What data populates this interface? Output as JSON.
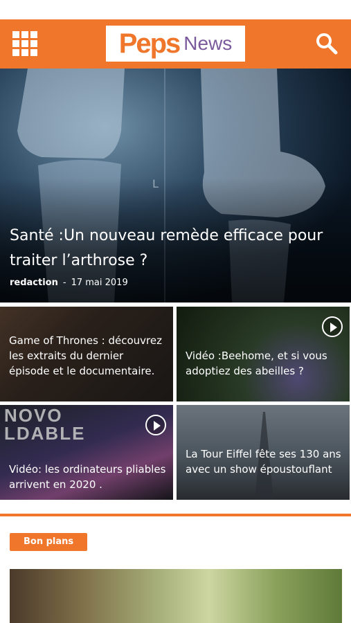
{
  "header": {
    "logo_part1": "Peps",
    "logo_part2": "News",
    "menu_icon": "grid-menu-icon",
    "search_icon": "search-icon",
    "brand_color": "#f0762b"
  },
  "hero": {
    "title": "Santé :Un nouveau remède efficace pour traiter l’arthrose ?",
    "author": "redaction",
    "separator": "-",
    "date": "17 mai 2019"
  },
  "cards": [
    {
      "title": "Game of Thrones : découvrez les extraits du dernier épisode et le documentaire.",
      "video": false
    },
    {
      "title": "Vidéo :Beehome, et si vous adoptiez des abeilles ?",
      "video": true
    },
    {
      "title": "Vidéo: les ordinateurs pliables arrivent en 2020 .",
      "video": true,
      "bg_text": "NOVO\nLDABLE"
    },
    {
      "title": "La Tour Eiffel fête ses 130 ans avec un show époustouflant",
      "video": false
    }
  ],
  "section": {
    "tag": "Bon plans"
  }
}
